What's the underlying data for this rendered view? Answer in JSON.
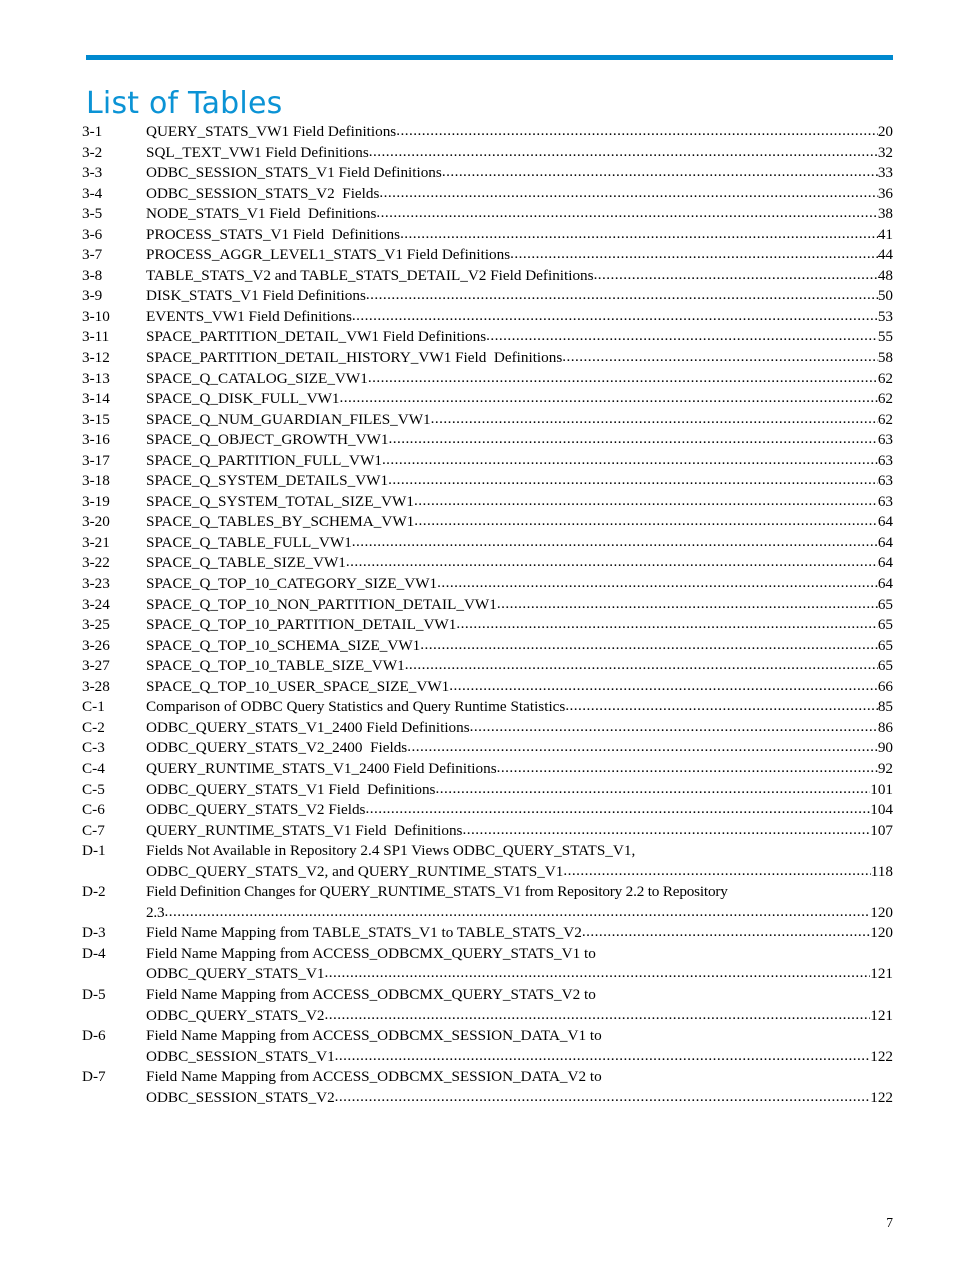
{
  "document": {
    "title": "List of Tables",
    "page_number": "7",
    "accent_color": "#0089cf",
    "title_color": "#0b93d5"
  },
  "toc": {
    "entries": [
      {
        "number": "3-1",
        "title": "QUERY_STATS_VW1 Field Definitions",
        "page": "20"
      },
      {
        "number": "3-2",
        "title": "SQL_TEXT_VW1 Field Definitions",
        "page": "32"
      },
      {
        "number": "3-3",
        "title": "ODBC_SESSION_STATS_V1 Field Definitions",
        "page": "33"
      },
      {
        "number": "3-4",
        "title": "ODBC_SESSION_STATS_V2  Fields",
        "page": "36"
      },
      {
        "number": "3-5",
        "title": "NODE_STATS_V1 Field  Definitions",
        "page": "38"
      },
      {
        "number": "3-6",
        "title": "PROCESS_STATS_V1 Field  Definitions",
        "page": "41"
      },
      {
        "number": "3-7",
        "title": "PROCESS_AGGR_LEVEL1_STATS_V1 Field Definitions",
        "page": "44"
      },
      {
        "number": "3-8",
        "title": "TABLE_STATS_V2 and TABLE_STATS_DETAIL_V2 Field Definitions",
        "page": "48"
      },
      {
        "number": "3-9",
        "title": "DISK_STATS_V1 Field Definitions",
        "page": "50"
      },
      {
        "number": "3-10",
        "title": "EVENTS_VW1 Field Definitions",
        "page": "53"
      },
      {
        "number": "3-11",
        "title": "SPACE_PARTITION_DETAIL_VW1 Field Definitions",
        "page": "55"
      },
      {
        "number": "3-12",
        "title": "SPACE_PARTITION_DETAIL_HISTORY_VW1 Field  Definitions",
        "page": "58"
      },
      {
        "number": "3-13",
        "title": "SPACE_Q_CATALOG_SIZE_VW1",
        "page": "62"
      },
      {
        "number": "3-14",
        "title": "SPACE_Q_DISK_FULL_VW1",
        "page": "62"
      },
      {
        "number": "3-15",
        "title": "SPACE_Q_NUM_GUARDIAN_FILES_VW1",
        "page": "62"
      },
      {
        "number": "3-16",
        "title": "SPACE_Q_OBJECT_GROWTH_VW1",
        "page": "63"
      },
      {
        "number": "3-17",
        "title": "SPACE_Q_PARTITION_FULL_VW1",
        "page": "63"
      },
      {
        "number": "3-18",
        "title": "SPACE_Q_SYSTEM_DETAILS_VW1",
        "page": "63"
      },
      {
        "number": "3-19",
        "title": "SPACE_Q_SYSTEM_TOTAL_SIZE_VW1",
        "page": "63"
      },
      {
        "number": "3-20",
        "title": "SPACE_Q_TABLES_BY_SCHEMA_VW1",
        "page": "64"
      },
      {
        "number": "3-21",
        "title": "SPACE_Q_TABLE_FULL_VW1",
        "page": "64"
      },
      {
        "number": "3-22",
        "title": "SPACE_Q_TABLE_SIZE_VW1",
        "page": "64"
      },
      {
        "number": "3-23",
        "title": "SPACE_Q_TOP_10_CATEGORY_SIZE_VW1",
        "page": "64"
      },
      {
        "number": "3-24",
        "title": "SPACE_Q_TOP_10_NON_PARTITION_DETAIL_VW1",
        "page": "65"
      },
      {
        "number": "3-25",
        "title": "SPACE_Q_TOP_10_PARTITION_DETAIL_VW1",
        "page": "65"
      },
      {
        "number": "3-26",
        "title": "SPACE_Q_TOP_10_SCHEMA_SIZE_VW1",
        "page": "65"
      },
      {
        "number": "3-27",
        "title": "SPACE_Q_TOP_10_TABLE_SIZE_VW1",
        "page": "65"
      },
      {
        "number": "3-28",
        "title": "SPACE_Q_TOP_10_USER_SPACE_SIZE_VW1",
        "page": "66"
      },
      {
        "number": "C-1",
        "title": "Comparison of ODBC Query Statistics and Query Runtime Statistics",
        "page": "85"
      },
      {
        "number": "C-2",
        "title": "ODBC_QUERY_STATS_V1_2400 Field Definitions",
        "page": "86"
      },
      {
        "number": "C-3",
        "title": "ODBC_QUERY_STATS_V2_2400  Fields",
        "page": "90"
      },
      {
        "number": "C-4",
        "title": "QUERY_RUNTIME_STATS_V1_2400 Field Definitions",
        "page": "92"
      },
      {
        "number": "C-5",
        "title": "ODBC_QUERY_STATS_V1 Field  Definitions",
        "page": "101"
      },
      {
        "number": "C-6",
        "title": "ODBC_QUERY_STATS_V2 Fields",
        "page": "104"
      },
      {
        "number": "C-7",
        "title": "QUERY_RUNTIME_STATS_V1 Field  Definitions",
        "page": "107"
      },
      {
        "number": "D-1",
        "line1": "Fields Not Available in Repository 2.4 SP1 Views ODBC_QUERY_STATS_V1,",
        "title": "ODBC_QUERY_STATS_V2, and QUERY_RUNTIME_STATS_V1",
        "page": "118"
      },
      {
        "number": "D-2",
        "line1": "Field Definition Changes for QUERY_RUNTIME_STATS_V1 from Repository 2.2 to Repository",
        "title": "2.3",
        "page": "120",
        "condensed": true
      },
      {
        "number": "D-3",
        "title": "Field Name Mapping from TABLE_STATS_V1 to TABLE_STATS_V2",
        "page": "120"
      },
      {
        "number": "D-4",
        "line1": "Field Name Mapping from ACCESS_ODBCMX_QUERY_STATS_V1 to",
        "title": "ODBC_QUERY_STATS_V1",
        "page": "121"
      },
      {
        "number": "D-5",
        "line1": "Field Name Mapping from ACCESS_ODBCMX_QUERY_STATS_V2 to",
        "title": "ODBC_QUERY_STATS_V2",
        "page": "121"
      },
      {
        "number": "D-6",
        "line1": "Field Name Mapping from ACCESS_ODBCMX_SESSION_DATA_V1 to",
        "title": "ODBC_SESSION_STATS_V1",
        "page": "122"
      },
      {
        "number": "D-7",
        "line1": "Field Name Mapping from ACCESS_ODBCMX_SESSION_DATA_V2 to",
        "title": "ODBC_SESSION_STATS_V2",
        "page": "122"
      }
    ]
  }
}
